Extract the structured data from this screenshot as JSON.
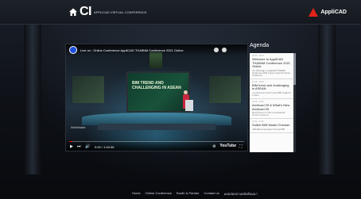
{
  "header": {
    "brand_logo": "CI",
    "brand_sub": "AppliCAD VIRTUAL CONFERENCE",
    "partner_logo": "AppliCAD"
  },
  "video": {
    "title": "Live on : Online Conference AppliCAD THAIBIM Conference 2021 Online",
    "screen_text": "BIM TREND AND CHALLENGING IN ASEAN",
    "watermark": "Worldwide",
    "progress": 0.02,
    "time": "0:00 / 1:04:36",
    "youtube_label": "YouTube"
  },
  "agenda": {
    "heading": "Agenda",
    "items": [
      {
        "time": "10:00 - 10:15",
        "title": "Welcome to AppliCAD THAIBIM Conference 2021 Online",
        "desc": "กล่าวต้อนรับสู่งาน AppliCAD THAIBIM Conference 2021 ในรูปแบบออนไลน์ Virtual Conference"
      },
      {
        "time": "10:15 - 10:45",
        "title": "BIM trend and challenging in ASEAN",
        "desc": "แนวโน้มและความท้าทายของ BIM ในภูมิภาคอาเซียน"
      },
      {
        "time": "10:45 - 11:15",
        "title": "Archicad 25 & What's New Archicad 25",
        "desc": "ฟีเจอร์ใหม่และการใช้งาน Archicad 25 สำหรับงานออกแบบ"
      },
      {
        "time": "11:15 - 11:45",
        "title": "Solibri BIM Model Checker",
        "desc": "เครื่องมือตรวจสอบคุณภาพโมเดล BIM"
      }
    ]
  },
  "footer": {
    "links": [
      "Home",
      "Online Conference",
      "Booth & Partner",
      "Contact us",
      "แบบสอบถามหลังสัมมนา"
    ]
  },
  "colors": {
    "accent_red": "#e2231a",
    "background": "#0b0d12"
  }
}
